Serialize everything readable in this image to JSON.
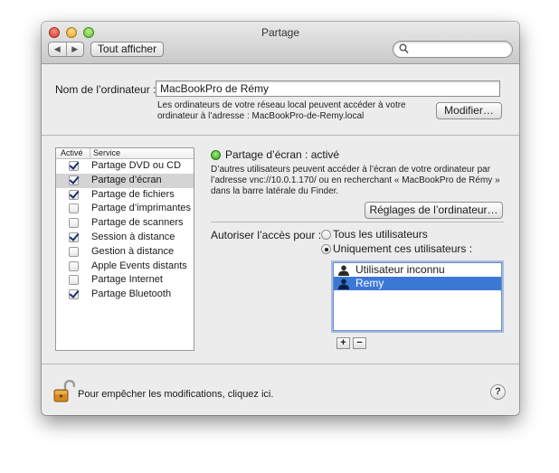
{
  "window": {
    "title": "Partage",
    "show_all": "Tout afficher",
    "search_placeholder": ""
  },
  "computer": {
    "label": "Nom de l’ordinateur :",
    "value": "MacBookPro de Rémy",
    "info_line1": "Les ordinateurs de votre réseau local peuvent accéder à votre",
    "info_line2": "ordinateur à l’adresse : MacBookPro-de-Remy.local",
    "modify_button": "Modifier…"
  },
  "services": {
    "header_active": "Activé",
    "header_service": "Service",
    "items": [
      {
        "label": "Partage DVD ou CD",
        "checked": true
      },
      {
        "label": "Partage d’écran",
        "checked": true
      },
      {
        "label": "Partage de fichiers",
        "checked": true
      },
      {
        "label": "Partage d’imprimantes",
        "checked": false
      },
      {
        "label": "Partage de scanners",
        "checked": false
      },
      {
        "label": "Session à distance",
        "checked": true
      },
      {
        "label": "Gestion à distance",
        "checked": false
      },
      {
        "label": "Apple Events distants",
        "checked": false
      },
      {
        "label": "Partage Internet",
        "checked": false
      },
      {
        "label": "Partage Bluetooth",
        "checked": true
      }
    ],
    "selected_index": 1
  },
  "detail": {
    "status": "Partage d’écran : activé",
    "status_color": "#2f9a1f",
    "desc_line1": "D’autres utilisateurs peuvent accéder à l’écran de votre ordinateur par",
    "desc_line2": "l’adresse vnc://10.0.1.170/ ou en recherchant « MacBookPro de Rémy »",
    "desc_line3": "dans la barre latérale du Finder.",
    "settings_button": "Réglages de l’ordinateur…",
    "allow_label": "Autoriser l’accès pour :",
    "option_all": "Tous les utilisateurs",
    "option_only": "Uniquement ces utilisateurs :",
    "selected_option": "only",
    "users": [
      {
        "label": "Utilisateur inconnu",
        "selected": false
      },
      {
        "label": "Remy",
        "selected": true
      }
    ],
    "add_label": "+",
    "remove_label": "−"
  },
  "footer": {
    "lock_text": "Pour empêcher les modifications, cliquez ici.",
    "help_label": "?"
  }
}
